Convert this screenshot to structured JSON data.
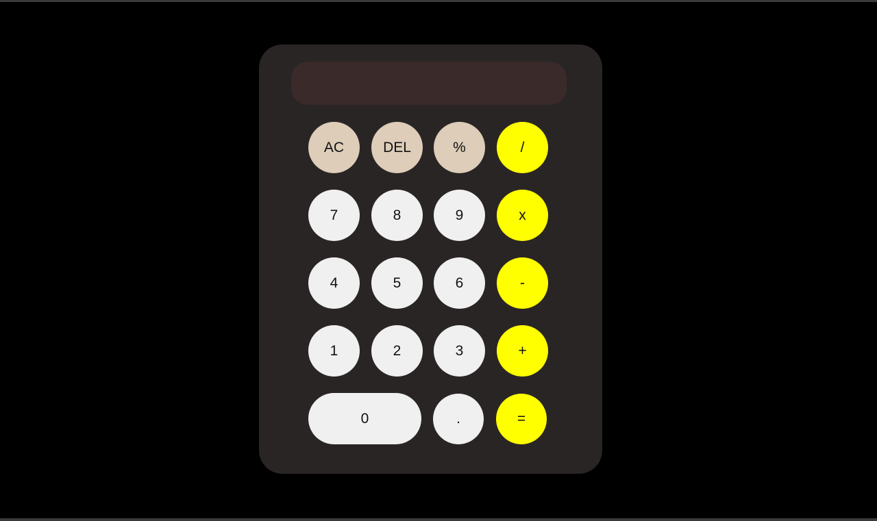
{
  "display": {
    "value": ""
  },
  "colors": {
    "page_background": "#000000",
    "calculator_body": "#2a2525",
    "display_background": "#3a2a2a",
    "function_key": "#ddcdb9",
    "number_key": "#f0f0f0",
    "operator_key": "#ffff00"
  },
  "keys": {
    "ac": "AC",
    "del": "DEL",
    "percent": "%",
    "divide": "/",
    "seven": "7",
    "eight": "8",
    "nine": "9",
    "multiply": "x",
    "four": "4",
    "five": "5",
    "six": "6",
    "subtract": "-",
    "one": "1",
    "two": "2",
    "three": "3",
    "add": "+",
    "zero": "0",
    "decimal": ".",
    "equals": "="
  }
}
